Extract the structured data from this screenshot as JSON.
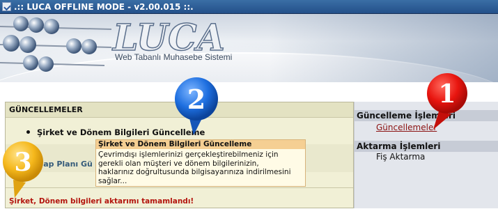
{
  "window": {
    "title": ".:: LUCA OFFLINE MODE - v2.00.015 ::."
  },
  "banner": {
    "tagline": "Web Tabanlı Muhasebe Sistemi"
  },
  "main": {
    "header": "GÜNCELLEMELER",
    "item1": "Şirket ve Dönem Bilgileri Güncelleme",
    "item2_partial": "Hesap Planı Gü",
    "status": "Şirket, Dönem bilgileri aktarımı tamamlandı!"
  },
  "tooltip": {
    "title": "Şirket ve Dönem Bilgileri Güncelleme",
    "line1": "Çevrimdışı işlemlerinizi gerçekleştirebilmeniz için",
    "line2": "gerekli olan müşteri ve dönem bilgilerinizin,",
    "line3": "haklarınız doğrultusunda bilgisayarınıza indirilmesini",
    "line4": "sağlar..."
  },
  "side": {
    "section1": "Güncelleme İşlemleri",
    "link1": "Güncellemeler",
    "section2": "Aktarma İşlemleri",
    "link2": "Fiş Aktarma"
  },
  "callouts": [
    {
      "label": "1",
      "color": "#e8150f"
    },
    {
      "label": "2",
      "color": "#1e6fe0"
    },
    {
      "label": "3",
      "color": "#f5b81c"
    }
  ]
}
